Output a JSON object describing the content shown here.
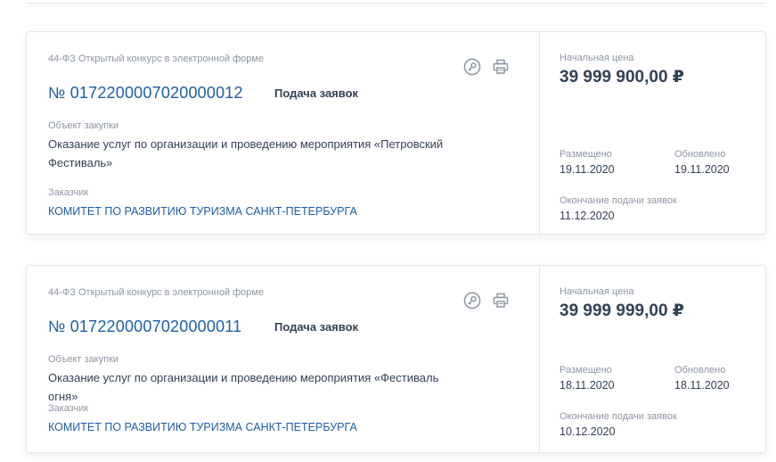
{
  "cards": [
    {
      "law_type": "44-ФЗ Открытый конкурс в электронной форме",
      "number": "№ 0172200007020000012",
      "status": "Подача заявок",
      "subject_label": "Объект закупки",
      "subject": "Оказание услуг по организации и проведению мероприятия «Петровский Фестиваль»",
      "customer_label": "Заказчик",
      "customer": "КОМИТЕТ ПО РАЗВИТИЮ ТУРИЗМА САНКТ-ПЕТЕРБУРГА",
      "price_label": "Начальная цена",
      "price": "39 999 900,00 ₽",
      "posted_label": "Размещено",
      "posted": "19.11.2020",
      "updated_label": "Обновлено",
      "updated": "19.11.2020",
      "deadline_label": "Окончание подачи заявок",
      "deadline": "11.12.2020"
    },
    {
      "law_type": "44-ФЗ Открытый конкурс в электронной форме",
      "number": "№ 0172200007020000011",
      "status": "Подача заявок",
      "subject_label": "Объект закупки",
      "subject": "Оказание услуг по организации и проведению мероприятия «Фестиваль огня»",
      "customer_label": "Заказчик",
      "customer": "КОМИТЕТ ПО РАЗВИТИЮ ТУРИЗМА САНКТ-ПЕТЕРБУРГА",
      "price_label": "Начальная цена",
      "price": "39 999 999,00 ₽",
      "posted_label": "Размещено",
      "posted": "18.11.2020",
      "updated_label": "Обновлено",
      "updated": "18.11.2020",
      "deadline_label": "Окончание подачи заявок",
      "deadline": "10.12.2020"
    }
  ],
  "icons": {
    "key": "key-icon",
    "print": "printer-icon"
  },
  "colors": {
    "link": "#1e5ea8",
    "text": "#334155",
    "muted": "#8d96a3",
    "border": "#e3e7ec"
  }
}
